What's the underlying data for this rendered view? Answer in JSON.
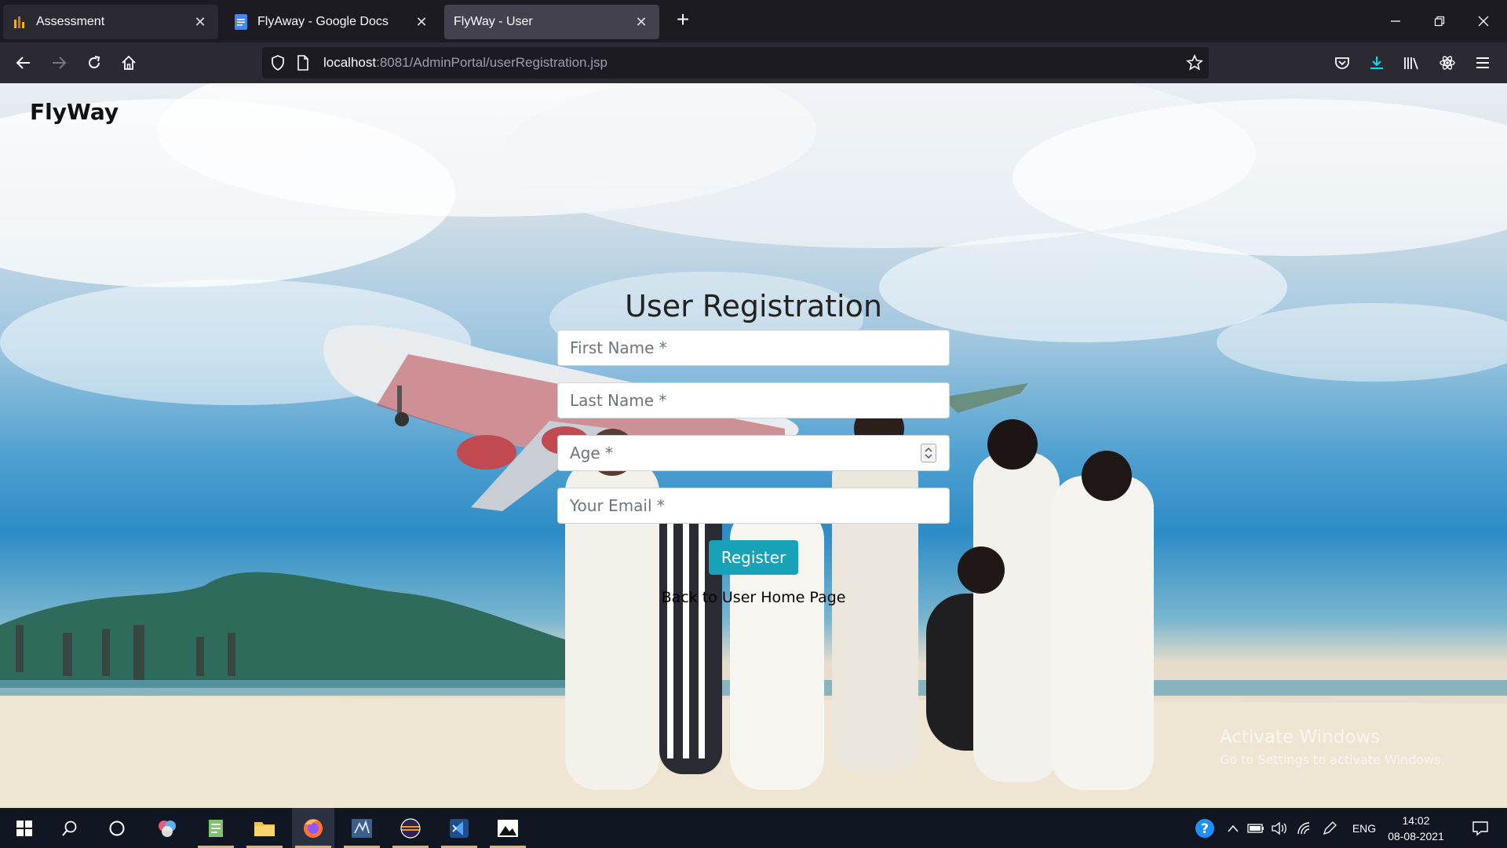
{
  "browser": {
    "tabs": [
      {
        "label": "Assessment",
        "icon": "bar-chart-icon"
      },
      {
        "label": "FlyAway - Google Docs",
        "icon": "google-docs-icon"
      },
      {
        "label": "FlyWay - User",
        "icon": "none",
        "active": true
      }
    ],
    "url_host": "localhost",
    "url_rest": ":8081/AdminPortal/userRegistration.jsp"
  },
  "page": {
    "brand": "FlyWay",
    "title": "User Registration",
    "fields": {
      "first_name": "First Name *",
      "last_name": "Last Name *",
      "age": "Age *",
      "email": "Your Email *"
    },
    "register_label": "Register",
    "back_link": "Back to User Home Page"
  },
  "watermark": {
    "line1": "Activate Windows",
    "line2": "Go to Settings to activate Windows."
  },
  "taskbar": {
    "language": "ENG",
    "time": "14:02",
    "date": "08-08-2021"
  },
  "colors": {
    "accent_button": "#17a2b8",
    "browser_bg": "#1c1b22",
    "toolbar_bg": "#2b2a33",
    "taskbar_bg": "#101723"
  }
}
